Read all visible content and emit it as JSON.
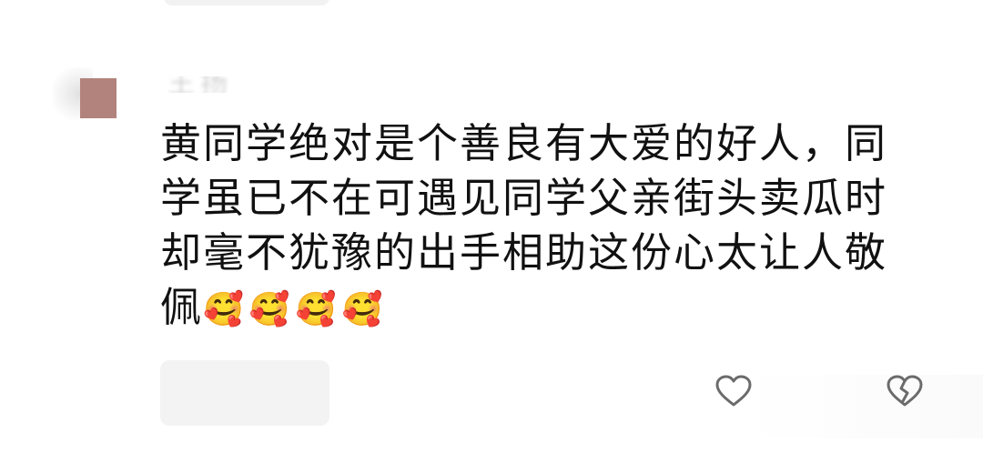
{
  "comment": {
    "username": "王扬",
    "text": "黄同学绝对是个善良有大爱的好人，同学虽已不在可遇见同学父亲街头卖瓜时却毫不犹豫的出手相助这份心太让人敬佩",
    "emojis": "🥰🥰🥰🥰"
  },
  "icons": {
    "like": "heart-outline-icon",
    "dislike": "broken-heart-outline-icon"
  },
  "colors": {
    "text": "#111111",
    "icon": "#6b6b6b",
    "placeholder": "#f3f3f3",
    "avatar": "#b2837c"
  }
}
